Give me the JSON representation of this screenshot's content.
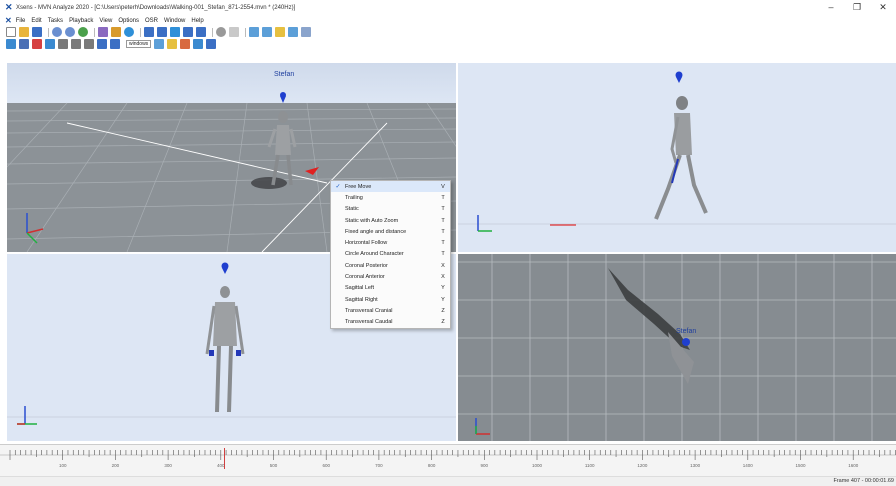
{
  "window": {
    "title": "Xsens - MVN Analyze 2020 - [C:\\Users\\peterh\\Downloads\\Walking-001_Stefan_871-2554.mvn * (240Hz)]",
    "controls": {
      "minimize": "–",
      "restore": "❐",
      "close": "✕"
    }
  },
  "menubar": {
    "items": [
      "File",
      "Edit",
      "Tasks",
      "Playback",
      "View",
      "Options",
      "OSR",
      "Window",
      "Help"
    ]
  },
  "toolbar2": {
    "window_selector": "windows"
  },
  "viewports": {
    "top_left": {
      "character_name": "Stefan"
    },
    "bottom_right": {
      "character_name": "Stefan"
    }
  },
  "context_menu": {
    "items": [
      {
        "label": "Free Move",
        "key": "V",
        "checked": true
      },
      {
        "label": "Trailing",
        "key": "T",
        "checked": false
      },
      {
        "label": "Static",
        "key": "T",
        "checked": false
      },
      {
        "label": "Static with Auto Zoom",
        "key": "T",
        "checked": false
      },
      {
        "label": "Fixed angle and distance",
        "key": "T",
        "checked": false
      },
      {
        "label": "Horizontal Follow",
        "key": "T",
        "checked": false
      },
      {
        "label": "Circle Around Character",
        "key": "T",
        "checked": false
      },
      {
        "label": "Coronal Posterior",
        "key": "X",
        "checked": false
      },
      {
        "label": "Coronal Anterior",
        "key": "X",
        "checked": false
      },
      {
        "label": "Sagittal Left",
        "key": "Y",
        "checked": false
      },
      {
        "label": "Sagittal Right",
        "key": "Y",
        "checked": false
      },
      {
        "label": "Transversal Cranial",
        "key": "Z",
        "checked": false
      },
      {
        "label": "Transversal Caudal",
        "key": "Z",
        "checked": false
      }
    ],
    "check_mark": "✓"
  },
  "timeline": {
    "labels": [
      "100",
      "200",
      "300",
      "400",
      "500",
      "600",
      "700",
      "800",
      "900",
      "1000",
      "1100",
      "1200",
      "1300",
      "1400",
      "1500",
      "1600"
    ],
    "playhead_frame": 407
  },
  "status": {
    "frame": "Frame 407 - 00:00:01.69"
  },
  "colors": {
    "accent": "#1c5fc7",
    "marker": "#1f3f9e",
    "playhead": "#d04040"
  }
}
